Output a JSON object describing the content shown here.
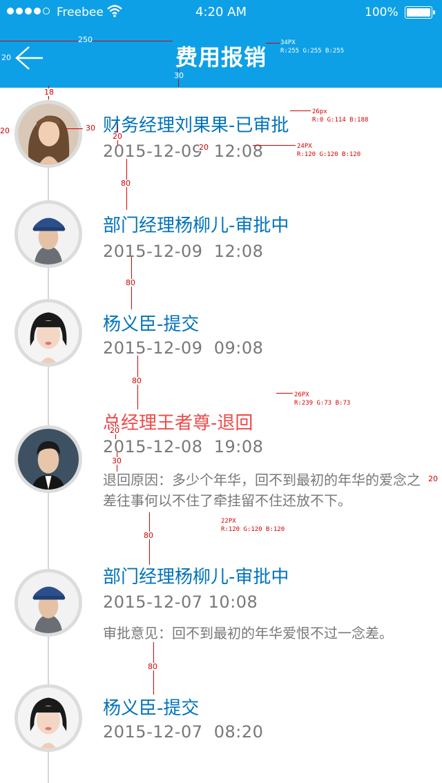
{
  "status_bar": {
    "carrier": "Freebee",
    "time": "4:20 AM",
    "battery": "100%",
    "signal_bars_filled": 4,
    "signal_bars_total": 5
  },
  "header": {
    "title": "费用报销",
    "back_icon": "back-arrow-icon",
    "background_color": "#0ea0e6"
  },
  "colors": {
    "name": "#0072bc",
    "rejected": "#ef4949",
    "date": "#787878",
    "annotation": "#d40000"
  },
  "timeline": [
    {
      "name": "财务经理刘果果-已审批",
      "date": "2015-12-09  12:08",
      "note": "",
      "status": "approved"
    },
    {
      "name": "部门经理杨柳儿-审批中",
      "date": "2015-12-09  12:08",
      "note": "",
      "status": "pending"
    },
    {
      "name": "杨义臣-提交",
      "date": "2015-12-09  09:08",
      "note": "",
      "status": "submitted"
    },
    {
      "name": "总经理王者尊-退回",
      "date": "2015-12-08  19:08",
      "note": "退回原因：多少个年华，回不到最初的年华的爱念之差往事何以不住了牵挂留不住还放不下。",
      "status": "rejected"
    },
    {
      "name": "部门经理杨柳儿-审批中",
      "date": "2015-12-07 10:08",
      "note": "审批意见：回不到最初的年华爱恨不过一念差。",
      "status": "pending"
    },
    {
      "name": "杨义臣-提交",
      "date": "2015-12-07  08:20",
      "note": "",
      "status": "submitted"
    }
  ],
  "annotations": {
    "title_spec": "34PX\nR:255 G:255 B:255",
    "name_spec": "26px\nR:0 G:114 B:188",
    "date_spec": "24PX\nR:120 G:120 B:120",
    "rejected_spec": "26PX\nR:239 G:73 B:73",
    "note_spec": "22PX\nR:120 G:120 B:120",
    "m250": "250",
    "m20": "20",
    "m30": "30",
    "m18": "18",
    "m80": "80"
  }
}
